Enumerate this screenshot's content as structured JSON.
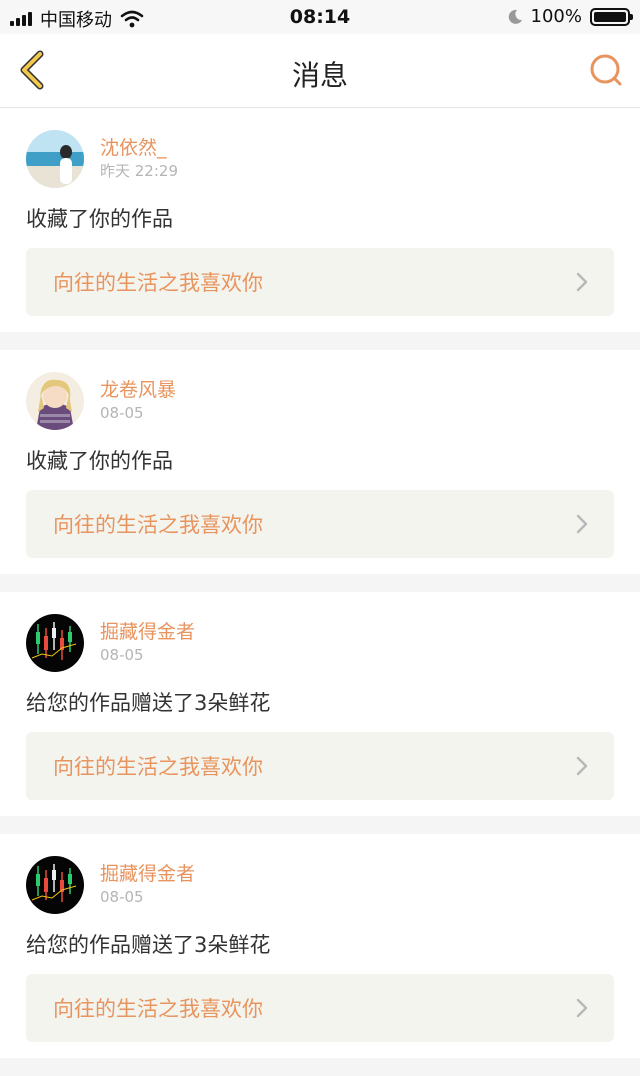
{
  "status_bar": {
    "carrier": "中国移动",
    "time": "08:14",
    "battery": "100%",
    "battery_level": 1.0
  },
  "header": {
    "title": "消息",
    "back_icon": "chevron-left-icon",
    "search_icon": "search-icon"
  },
  "colors": {
    "accent": "#e8945f",
    "back_icon": "#f2c94c",
    "link_bg": "#f4f4ee",
    "muted": "#b5b5b5"
  },
  "messages": [
    {
      "username": "沈依然_",
      "time": "昨天 22:29",
      "action": "收藏了你的作品",
      "work_title": "向往的生活之我喜欢你",
      "avatar": "beach-photo-avatar"
    },
    {
      "username": "龙卷风暴",
      "time": "08-05",
      "action": "收藏了你的作品",
      "work_title": "向往的生活之我喜欢你",
      "avatar": "anime-character-avatar"
    },
    {
      "username": "掘藏得金者",
      "time": "08-05",
      "action": "给您的作品赠送了3朵鲜花",
      "work_title": "向往的生活之我喜欢你",
      "avatar": "stock-chart-avatar"
    },
    {
      "username": "掘藏得金者",
      "time": "08-05",
      "action": "给您的作品赠送了3朵鲜花",
      "work_title": "向往的生活之我喜欢你",
      "avatar": "stock-chart-avatar"
    }
  ]
}
